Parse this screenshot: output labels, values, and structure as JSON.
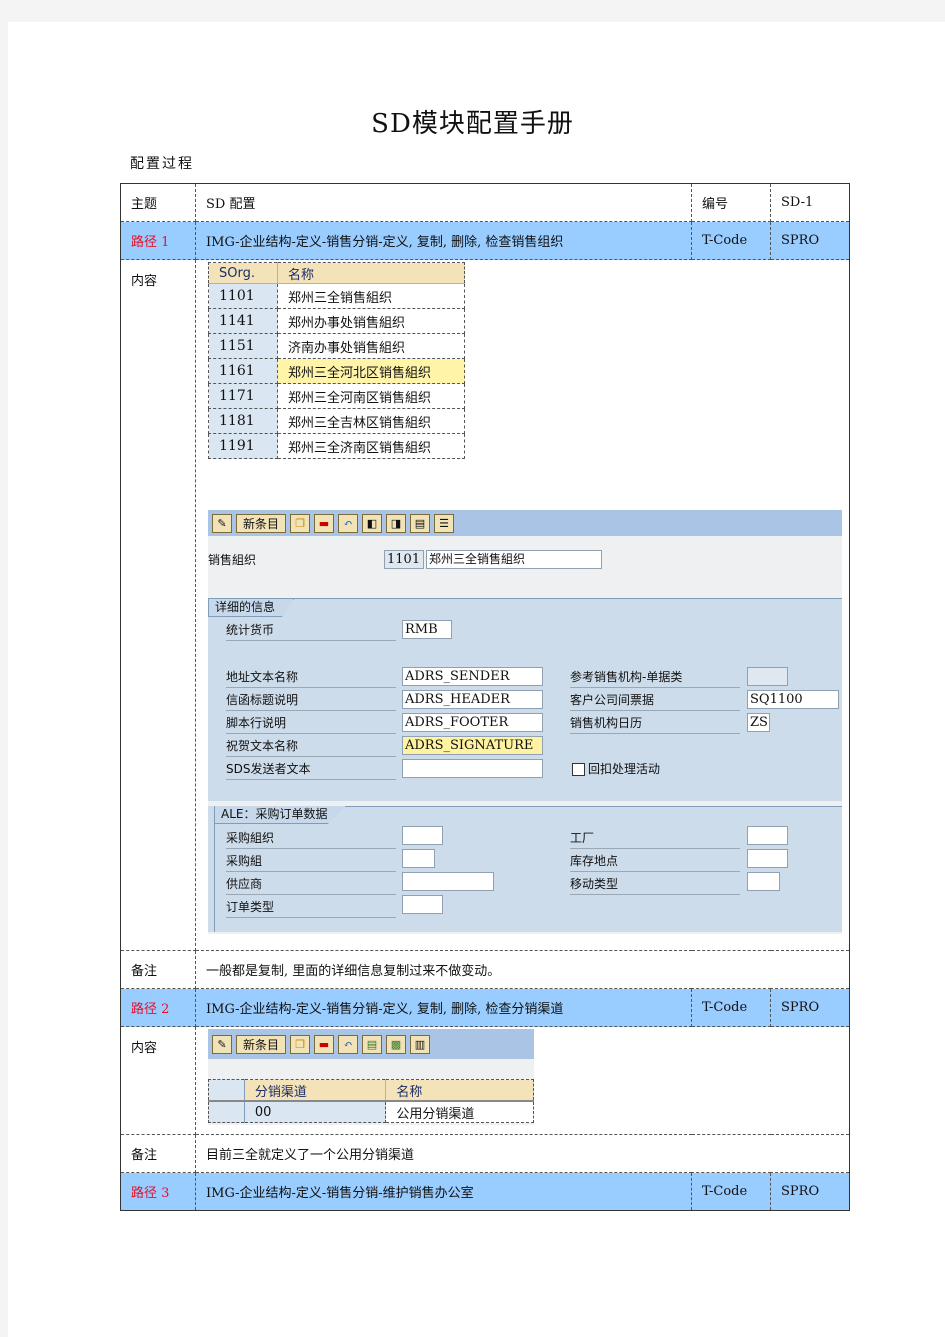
{
  "document": {
    "title": "SD模块配置手册",
    "subtitle": "配置过程"
  },
  "header_row": {
    "topic_label": "主题",
    "topic_value": "SD 配置",
    "number_label": "编号",
    "number_value": "SD-1"
  },
  "paths": [
    {
      "label": "路径 1",
      "value": "IMG-企业结构-定义-销售分销-定义, 复制, 删除, 检查销售组织",
      "tcode_label": "T-Code",
      "tcode_value": "SPRO"
    },
    {
      "label": "路径 2",
      "value": "IMG-企业结构-定义-销售分销-定义, 复制, 删除, 检查分销渠道",
      "tcode_label": "T-Code",
      "tcode_value": "SPRO"
    },
    {
      "label": "路径 3",
      "value": "IMG-企业结构-定义-销售分销-维护销售办公室",
      "tcode_label": "T-Code",
      "tcode_value": "SPRO"
    }
  ],
  "content_label": "内容",
  "note_label": "备注",
  "notes": [
    "一般都是复制, 里面的详细信息复制过来不做变动。",
    "目前三全就定义了一个公用分销渠道"
  ],
  "sales_org_grid": {
    "columns": [
      "SOrg.",
      "名称"
    ],
    "rows": [
      {
        "code": "1101",
        "name": "郑州三全销售組织"
      },
      {
        "code": "1141",
        "name": "郑州办事处销售組织"
      },
      {
        "code": "1151",
        "name": "济南办事处销售組织"
      },
      {
        "code": "1161",
        "name": "郑州三全河北区销售組织",
        "selected": true
      },
      {
        "code": "1171",
        "name": "郑州三全河南区销售組织"
      },
      {
        "code": "1181",
        "name": "郑州三全吉林区销售組织"
      },
      {
        "code": "1191",
        "name": "郑州三全济南区销售組织"
      }
    ]
  },
  "toolbar": {
    "new_entry_label": "新条目",
    "icons": [
      "edit-pencil-icon",
      "copy-icon",
      "delete-icon",
      "undo-icon",
      "previous-entry-icon",
      "next-entry-icon",
      "select-all-icon",
      "details-icon"
    ]
  },
  "sales_org_detail": {
    "label": "销售組织",
    "code": "1101",
    "name": "郑州三全销售組织",
    "detail_tab": "详细的信息",
    "stat_currency_label": "统计货币",
    "stat_currency_value": "RMB",
    "left_fields": [
      {
        "label": "地址文本名称",
        "value": "ADRS_SENDER"
      },
      {
        "label": "信函标题说明",
        "value": "ADRS_HEADER"
      },
      {
        "label": "脚本行说明",
        "value": "ADRS_FOOTER"
      },
      {
        "label": "祝贺文本名称",
        "value": "ADRS_SIGNATURE"
      },
      {
        "label": "SDS发送者文本",
        "value": ""
      }
    ],
    "right_fields": [
      {
        "label": "参考销售机构-单据类",
        "value": ""
      },
      {
        "label": "客户公司间票据",
        "value": "SQ1100"
      },
      {
        "label": "销售机构日历",
        "value": "ZS"
      }
    ],
    "checkbox_label": "回扣处理活动",
    "checkbox_checked": false,
    "ale_tab": "ALE：采购订单数据",
    "ale_left": [
      {
        "label": "采购組织",
        "value": ""
      },
      {
        "label": "采购組",
        "value": ""
      },
      {
        "label": "供应商",
        "value": ""
      },
      {
        "label": "订单类型",
        "value": ""
      }
    ],
    "ale_right": [
      {
        "label": "工厂",
        "value": ""
      },
      {
        "label": "库存地点",
        "value": ""
      },
      {
        "label": "移动类型",
        "value": ""
      }
    ]
  },
  "dist_channel_grid": {
    "columns": [
      "分销渠道",
      "名称"
    ],
    "rows": [
      {
        "code": "00",
        "name": "公用分销渠道"
      }
    ]
  }
}
